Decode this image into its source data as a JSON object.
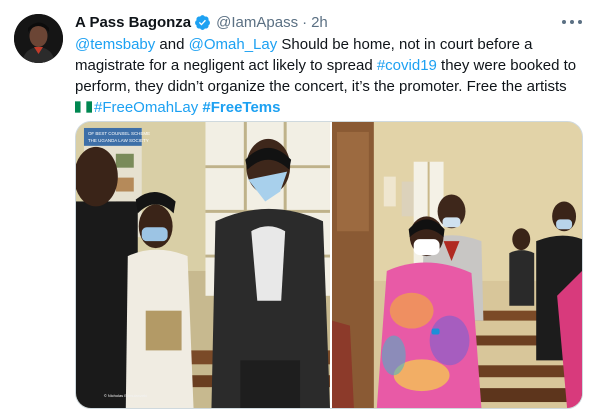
{
  "tweet": {
    "author_name": "A Pass Bagonza",
    "handle": "@IamApass",
    "separator": "·",
    "time": "2h",
    "text_segments": {
      "mention1": "@temsbaby",
      "and": " and ",
      "mention2": "@Omah_Lay",
      "body1": " Should be home, not in court before a magistrate for a negligent act likely  to spread ",
      "hashtag_covid": "#covid19",
      "body2": " they were booked to perform, they didn’t organize the concert, it’s the promoter. Free the artists ",
      "hashtag_omah": "#FreeOmahLay",
      "space": " ",
      "hashtag_tems": "#FreeTems"
    },
    "photo_poster_lines": [
      "OF BEST COUNSEL SCHEME",
      "THE UGANDA LAW SOCIETY"
    ],
    "photo_watermark": "© Nicholas Bamulanzeki"
  },
  "icons": {
    "verified": "verified-badge-icon",
    "more": "more-options-icon",
    "flag": "nigeria-flag-emoji"
  },
  "colors": {
    "link": "#1da1f2",
    "secondary_text": "#5b7083",
    "border": "#cfd9de",
    "verified": "#1da1f2"
  }
}
